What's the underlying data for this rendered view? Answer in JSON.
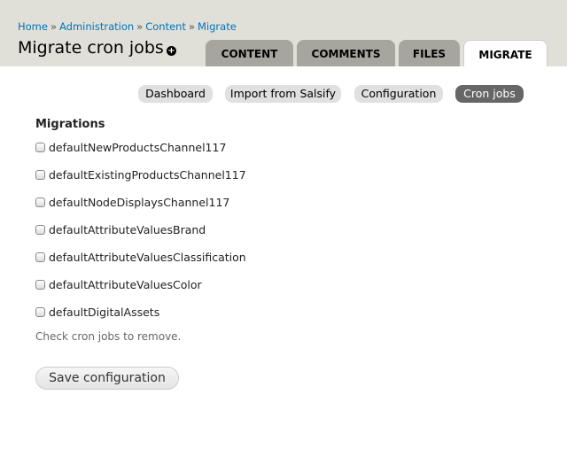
{
  "breadcrumb": [
    "Home",
    "Administration",
    "Content",
    "Migrate"
  ],
  "breadcrumb_separator": "»",
  "page_title": "Migrate cron jobs",
  "shortcut_icon": "plus-circle-icon",
  "tabs": [
    {
      "label": "CONTENT"
    },
    {
      "label": "COMMENTS"
    },
    {
      "label": "FILES"
    },
    {
      "label": "MIGRATE",
      "active": true
    }
  ],
  "subtabs": [
    {
      "label": "Dashboard"
    },
    {
      "label": "Import from Salsify"
    },
    {
      "label": "Configuration"
    },
    {
      "label": "Cron jobs",
      "active": true
    }
  ],
  "form": {
    "label": "Migrations",
    "items": [
      "defaultNewProductsChannel117",
      "defaultExistingProductsChannel117",
      "defaultNodeDisplaysChannel117",
      "defaultAttributeValuesBrand",
      "defaultAttributeValuesClassification",
      "defaultAttributeValuesColor",
      "defaultDigitalAssets"
    ],
    "description": "Check cron jobs to remove.",
    "save_label": "Save configuration"
  }
}
